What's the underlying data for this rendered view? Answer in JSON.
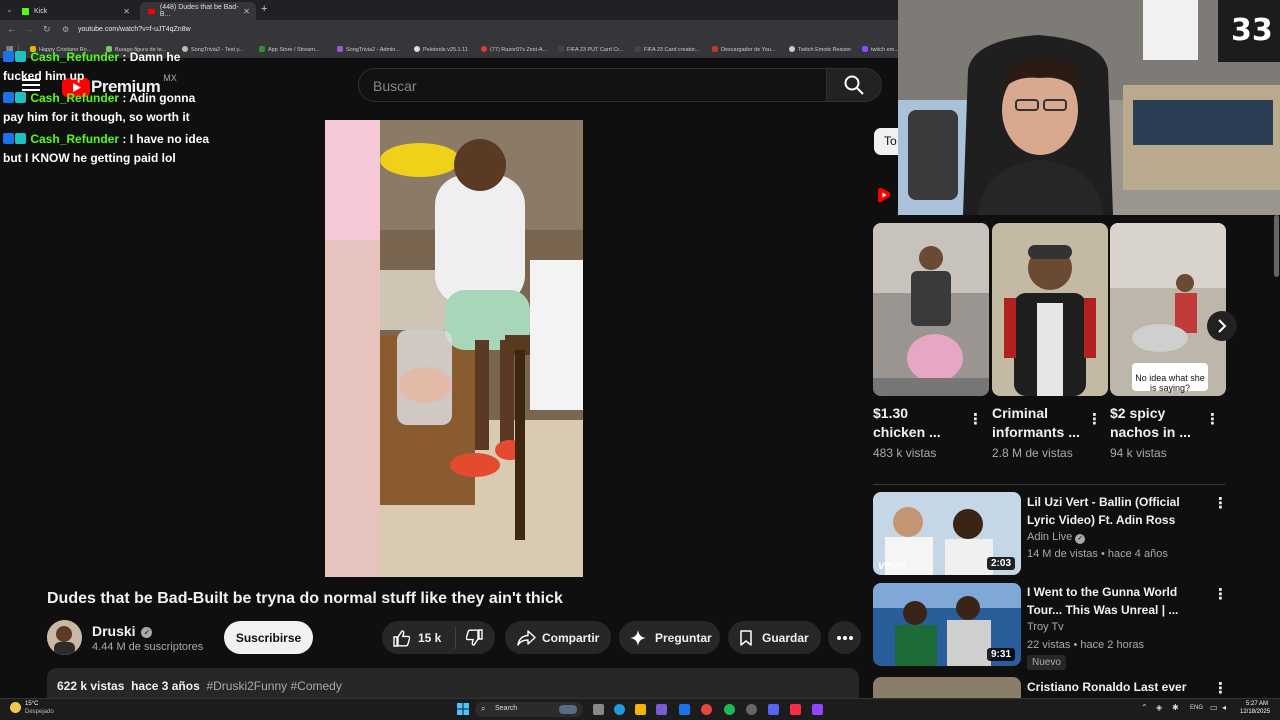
{
  "browser": {
    "tabs": [
      {
        "label": "Kick",
        "active": false
      },
      {
        "label": "(448) Dudes that be Bad-B...",
        "active": true
      }
    ],
    "url": "youtube.com/watch?v=f-uJT4qZn8w",
    "bookmarks": [
      "Happy Cristiano Ro...",
      "Burago figura de te...",
      "SongTrivia2 - Test y...",
      "App Store / Stream...",
      "SongTrivia2 - Admin...",
      "Peletools v25.1.11",
      "(77) Razor97s Zest-A...",
      "FIFA 23 PUT Card Cr...",
      "FIFA 23 Card creator...",
      "Descargador de You...",
      "Twitch Emote Resizer",
      "twitch em..."
    ]
  },
  "youtube": {
    "logo_text": "Premium",
    "region": "MX",
    "search_placeholder": "Buscar",
    "partial_chip": "To",
    "video": {
      "title": "Dudes that be Bad-Built be tryna do normal stuff like they ain't thick",
      "channel": "Druski",
      "subscribers": "4.44 M de suscriptores",
      "subscribe_label": "Suscribirse",
      "likes": "15 k",
      "share_label": "Compartir",
      "ask_label": "Preguntar",
      "save_label": "Guardar",
      "views_label": "622 k vistas",
      "age_label": "hace 3 años",
      "tags": "#Druski2Funny #Comedy"
    },
    "shorts": [
      {
        "title_line1": "$1.30",
        "title_line2": "chicken ...",
        "views": "483 k vistas"
      },
      {
        "title_line1": "Criminal",
        "title_line2": "informants ...",
        "views": "2.8 M de vistas"
      },
      {
        "title_line1": "$2 spicy",
        "title_line2": "nachos in ...",
        "views": "94 k vistas",
        "caption": "No idea what she is saying?"
      }
    ],
    "related": [
      {
        "title": "Lil Uzi Vert - Ballin (Official Lyric Video) Ft. Adin Ross",
        "channel": "Adin Live",
        "meta": "14 M de vistas • hace 4 años",
        "duration": "2:03",
        "brand": "vevo"
      },
      {
        "title": "I Went to the Gunna World Tour... This Was Unreal | ...",
        "channel": "Troy Tv",
        "meta": "22 vistas • hace 2 horas",
        "duration": "9:31",
        "badge": "Nuevo"
      },
      {
        "title": "Cristiano Ronaldo Last ever"
      }
    ]
  },
  "chat": {
    "messages": [
      {
        "user": "Cash_Refunder",
        "text": "Damn he fucked him up"
      },
      {
        "user": "Cash_Refunder",
        "text": "Adin gonna pay him for it though, so worth it"
      },
      {
        "user": "Cash_Refunder",
        "text": "I have no idea but I KNOW he getting paid lol"
      }
    ]
  },
  "taskbar": {
    "weather_temp": "15°C",
    "weather_desc": "Despejado",
    "search_label": "Search",
    "lang": "ENG",
    "time": "5:27 AM",
    "date": "12/18/2025"
  },
  "colors": {
    "kick_green": "#53fc18",
    "yt_red": "#ff0000",
    "bg": "#0f0f0f"
  }
}
